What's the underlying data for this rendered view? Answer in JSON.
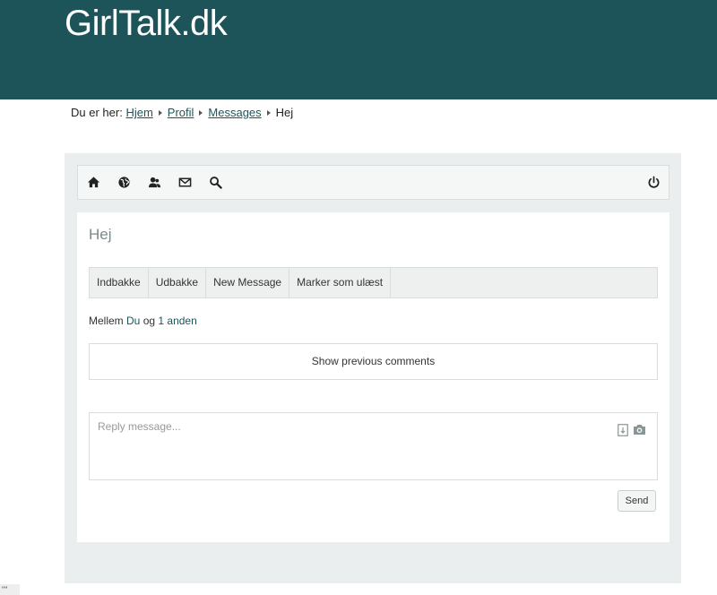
{
  "site": {
    "title": "GirlTalk.dk"
  },
  "breadcrumb": {
    "prefix": "Du er her:",
    "items": [
      "Hjem",
      "Profil",
      "Messages"
    ],
    "current": "Hej"
  },
  "toolbar": {
    "icons": [
      "home-icon",
      "globe-icon",
      "users-icon",
      "mail-icon",
      "search-icon",
      "power-icon"
    ]
  },
  "message": {
    "title": "Hej",
    "tabs": [
      "Indbakke",
      "Udbakke",
      "New Message",
      "Marker som ulæst"
    ],
    "between_prefix": "Mellem",
    "between_user": "Du",
    "between_and": "og",
    "between_others": "1 anden",
    "show_previous": "Show previous comments",
    "reply_placeholder": "Reply message...",
    "send_label": "Send"
  },
  "corner_text": "\"\""
}
